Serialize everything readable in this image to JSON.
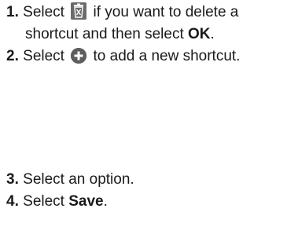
{
  "steps": [
    {
      "num": "1.",
      "text_before_icon": "Select",
      "icon": "trash-icon",
      "text_after_icon": "if you want to delete a",
      "line2_before": "shortcut and then select",
      "line2_bold": "OK",
      "line2_after": "."
    },
    {
      "num": "2.",
      "text_before_icon": "Select",
      "icon": "add-circle-icon",
      "text_after_icon": "to add a new shortcut."
    },
    {
      "num": "3.",
      "text": "Select an option."
    },
    {
      "num": "4.",
      "text_before": "Select",
      "bold": "Save",
      "text_after": "."
    }
  ],
  "colors": {
    "text": "#1a1a1a",
    "icon_fill": "#6b6b6b"
  }
}
